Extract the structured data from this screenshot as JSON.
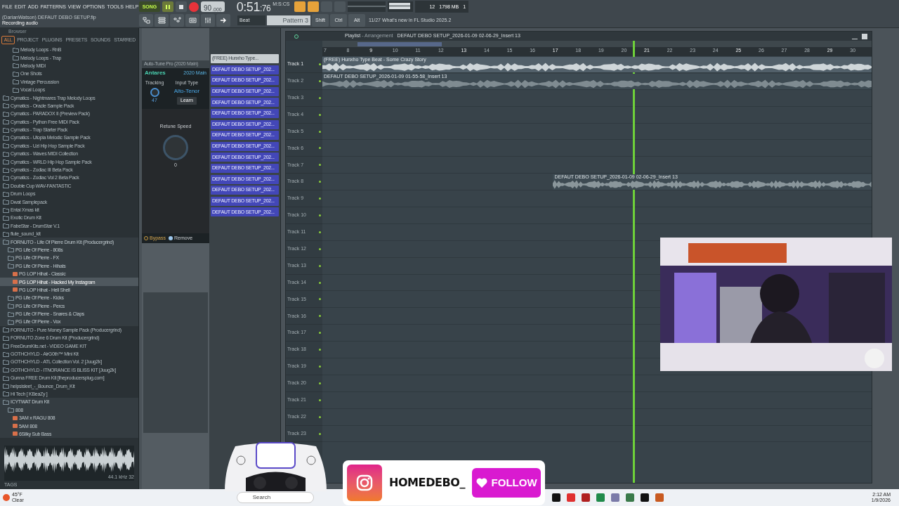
{
  "menu": [
    "FILE",
    "EDIT",
    "ADD",
    "PATTERNS",
    "VIEW",
    "OPTIONS",
    "TOOLS",
    "HELP"
  ],
  "project": {
    "title": "(DarianWatson) DEFAUT DEBO SETUP.flp",
    "status": "Recording audio"
  },
  "transport": {
    "mode": "SONG",
    "recording": true,
    "tempo": "90",
    "tempo_fraction": ".000"
  },
  "time": {
    "main": "0:51",
    "sub": ":76",
    "unit": "M:S:CS"
  },
  "meters": {
    "voices": "12",
    "memory": "1798 MB",
    "count": "1"
  },
  "snap": "Beat",
  "pattern": "Pattern 3",
  "modifier_keys": [
    "Shift",
    "Ctrl",
    "Alt"
  ],
  "news": {
    "date": "11/27",
    "text": "What's new in FL Studio 2025.2"
  },
  "browser": {
    "title": "Browser",
    "tabs": [
      {
        "label": "ALL",
        "selected": true
      },
      {
        "label": "PROJECT",
        "selected": false
      },
      {
        "label": "PLUGINS",
        "selected": false
      },
      {
        "label": "PRESETS",
        "selected": false
      },
      {
        "label": "SOUNDS",
        "selected": false
      },
      {
        "label": "STARRED",
        "selected": false
      }
    ],
    "continued_items": [
      {
        "label": "Melody Loops - RnB",
        "kind": "folder"
      },
      {
        "label": "Melody Loops - Trap",
        "kind": "folder"
      },
      {
        "label": "Melody MIDI",
        "kind": "folder"
      },
      {
        "label": "One Shots",
        "kind": "folder"
      },
      {
        "label": "Vintage Percussion",
        "kind": "folder"
      },
      {
        "label": "Vocal Loops",
        "kind": "folder"
      }
    ],
    "items": [
      {
        "label": "Cymatics - Nightmares Trap Melody Loops",
        "kind": "folder",
        "selected": false
      },
      {
        "label": "Cymatics - Oracle Sample Pack",
        "kind": "folder",
        "selected": false
      },
      {
        "label": "Cymatics - PARADOX II (Preview Pack)",
        "kind": "folder",
        "selected": false
      },
      {
        "label": "Cymatics - Python Free MIDI Pack",
        "kind": "folder",
        "selected": false
      },
      {
        "label": "Cymatics - Trap Starter Pack",
        "kind": "folder",
        "selected": false
      },
      {
        "label": "Cymatics - Utopia Melodic Sample Pack",
        "kind": "folder",
        "selected": false
      },
      {
        "label": "Cymatics - Uzi Hip Hop Sample Pack",
        "kind": "folder",
        "selected": false
      },
      {
        "label": "Cymatics - Waves MIDI Collection",
        "kind": "folder",
        "selected": false
      },
      {
        "label": "Cymatics - WRLD Hip Hop Sample Pack",
        "kind": "folder",
        "selected": false
      },
      {
        "label": "Cymatics - Zodiac III Beta Pack",
        "kind": "folder",
        "selected": false
      },
      {
        "label": "Cymatics - Zodiac Vol 2 Beta Pack",
        "kind": "folder",
        "selected": false
      },
      {
        "label": "Double Cup WAV-FANTASTiC",
        "kind": "folder",
        "selected": false
      },
      {
        "label": "Drum Loops",
        "kind": "folder",
        "selected": false
      },
      {
        "label": "Dwat Samplepack",
        "kind": "folder",
        "selected": false
      },
      {
        "label": "Entai Xmas kit",
        "kind": "folder",
        "selected": false
      },
      {
        "label": "Exotic Drum Kit",
        "kind": "folder",
        "selected": false
      },
      {
        "label": "FabeStar - DrumStar V.1",
        "kind": "folder",
        "selected": false
      },
      {
        "label": "flute_sound_kit",
        "kind": "folder",
        "selected": false
      },
      {
        "label": "FORNUTO - Life Of Pierre Drum Kit (Producergrind)",
        "kind": "folder",
        "selected": false,
        "children": [
          {
            "label": "PG Life Of Pierre - 808s",
            "kind": "folder",
            "selected": false
          },
          {
            "label": "PG Life Of Pierre - FX",
            "kind": "folder",
            "selected": false
          },
          {
            "label": "PG Life Of Pierre - Hihats",
            "kind": "folder",
            "selected": false,
            "children": [
              {
                "label": "PG LOP Hihat - Classic",
                "kind": "file",
                "selected": false
              },
              {
                "label": "PG LOP Hihat - Hacked My Instagram",
                "kind": "file",
                "selected": true
              },
              {
                "label": "PG LOP Hihat - Hell Shell",
                "kind": "file",
                "selected": false
              }
            ]
          },
          {
            "label": "PG Life Of Pierre - Kicks",
            "kind": "folder",
            "selected": false
          },
          {
            "label": "PG Life Of Pierre - Percs",
            "kind": "folder",
            "selected": false
          },
          {
            "label": "PG Life Of Pierre - Snares & Claps",
            "kind": "folder",
            "selected": false
          },
          {
            "label": "PG Life Of Pierre - Vox",
            "kind": "folder",
            "selected": false
          }
        ]
      },
      {
        "label": "FORNUTO - Pure Money Sample Pack (Producergrind)",
        "kind": "folder",
        "selected": false
      },
      {
        "label": "FORNUTO Zone 6 Drum Kit (Producergrind)",
        "kind": "folder",
        "selected": false
      },
      {
        "label": "FreeDrumKits.net - VIDEO GAME KIT",
        "kind": "folder",
        "selected": false
      },
      {
        "label": "GOTHCHYLD - AirG0th™ Mini Kit",
        "kind": "folder",
        "selected": false
      },
      {
        "label": "GOTHCHYLD - ATL Collection Vol. 2 [Juug2k]",
        "kind": "folder",
        "selected": false
      },
      {
        "label": "GOTHCHYLD - ITNORANCE IS BLISS KIT [Juug2k]",
        "kind": "folder",
        "selected": false
      },
      {
        "label": "Gunna FREE Drum Kit [theproducersplug.com]",
        "kind": "folder",
        "selected": false
      },
      {
        "label": "helpsisleet_-_Bounce_Drum_Kit",
        "kind": "folder",
        "selected": false
      },
      {
        "label": "Hi Tech [ KBeaZy ]",
        "kind": "folder",
        "selected": false
      },
      {
        "label": "ICYTWAT Drum Kit",
        "kind": "folder",
        "selected": false,
        "children": [
          {
            "label": "808",
            "kind": "folder",
            "selected": false,
            "children": [
              {
                "label": "3AM x RAGU 808",
                "kind": "file",
                "selected": false
              },
              {
                "label": "5AM 808",
                "kind": "file",
                "selected": false
              },
              {
                "label": "6Silky Sub Bass",
                "kind": "file",
                "selected": false
              }
            ]
          }
        ]
      }
    ],
    "sample_info": "44.1 kHz 32",
    "tags_label": "TAGS"
  },
  "plugin": {
    "title": "Auto-Tune Pro",
    "subtitle": "(2020 Main)",
    "brand": "Antares",
    "preset": "2020 Main",
    "tracking_label": "Tracking",
    "tracking_value": "47",
    "input_type_label": "Input Type",
    "input_type": "Alto-Tenor",
    "learn": "Learn",
    "retune_label": "Retune Speed",
    "retune_value": "0",
    "bypass": "Bypass",
    "remove": "Remove"
  },
  "channels": [
    "(FREE) Hunxho Type...",
    "DEFAUT DEBO SETUP_202...",
    "DEFAUT DEBO SETUP_202...",
    "DEFAUT DEBO SETUP_202...",
    "DEFAUT DEBO SETUP_202...",
    "DEFAUT DEBO SETUP_202...",
    "DEFAUT DEBO SETUP_202...",
    "DEFAUT DEBO SETUP_202...",
    "DEFAUT DEBO SETUP_202...",
    "DEFAUT DEBO SETUP_202...",
    "DEFAUT DEBO SETUP_202...",
    "DEFAUT DEBO SETUP_202...",
    "DEFAUT DEBO SETUP_202...",
    "DEFAUT DEBO SETUP_202...",
    "DEFAUT DEBO SETUP_202..."
  ],
  "playlist": {
    "title": "Playlist",
    "view": "- Arrangement",
    "file": "DEFAUT DEBO SETUP_2026-01-09 02-06-29_Insert 13",
    "bars": [
      "7",
      "8",
      "9",
      "10",
      "11",
      "12",
      "13",
      "14",
      "15",
      "16",
      "17",
      "18",
      "19",
      "20",
      "21",
      "22",
      "23",
      "24",
      "25",
      "26",
      "27",
      "28",
      "29",
      "30"
    ],
    "playhead": {
      "level": 0.565
    },
    "tracks": [
      "Track 1",
      "Track 2",
      "Track 3",
      "Track 4",
      "Track 5",
      "Track 6",
      "Track 7",
      "Track 8",
      "Track 9",
      "Track 10",
      "Track 11",
      "Track 12",
      "Track 13",
      "Track 14",
      "Track 15",
      "Track 16",
      "Track 17",
      "Track 18",
      "Track 19",
      "Track 20",
      "Track 21",
      "Track 22",
      "Track 23"
    ],
    "clips": [
      {
        "label": "(FREE) Hunxho Type Beat - Some Crazy Story"
      },
      {
        "label": "DEFAUT DEBO SETUP_2026-01-09 01-55-58_Insert 13"
      },
      {
        "label": "DEFAUT DEBO SETUP_2026-01-09 02-06-29_Insert 13"
      }
    ]
  },
  "overlay": {
    "handle": "HOMEDEBO_",
    "follow": "FOLLOW"
  },
  "taskbar": {
    "temperature": "45°F",
    "weather": "Clear",
    "search": "Search",
    "time": "2:12 AM",
    "date": "1/9/2026"
  }
}
